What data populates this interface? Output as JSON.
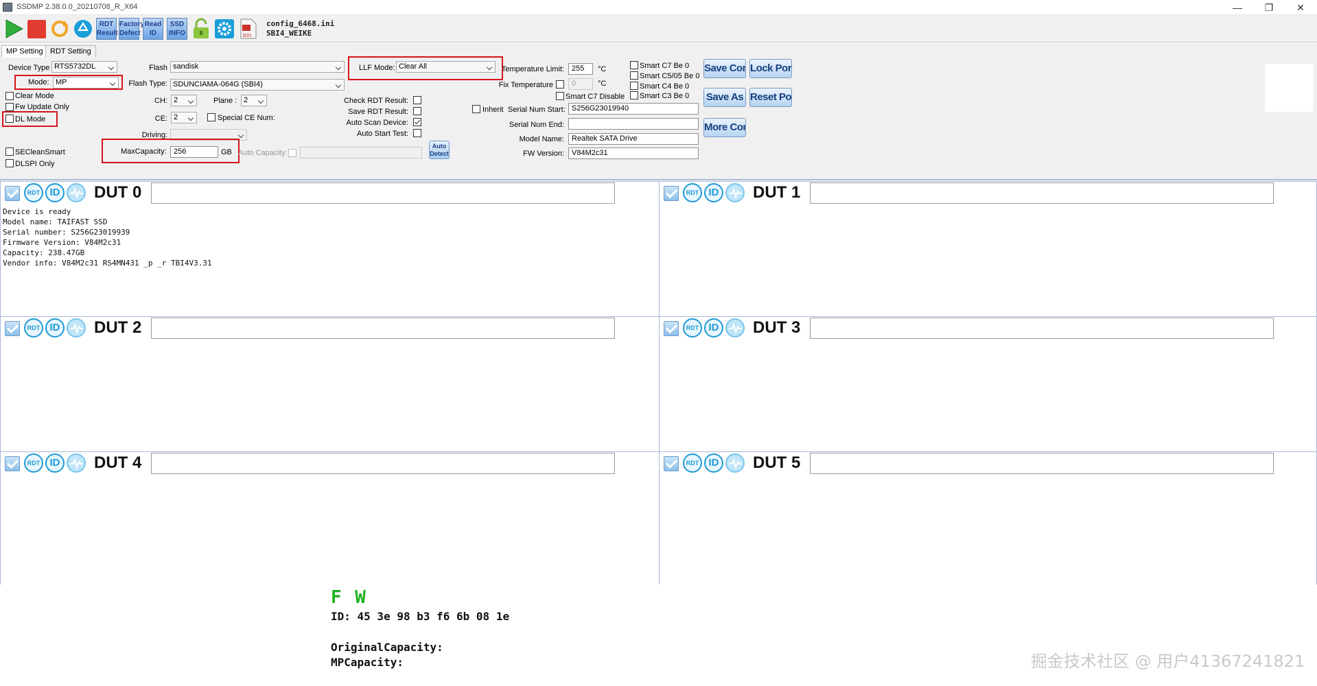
{
  "window": {
    "title": "SSDMP 2.38.0.0_20210708_R_X64",
    "minimize_glyph": "—",
    "restore_glyph": "❐",
    "close_glyph": "✕"
  },
  "toolbar": {
    "start_icon": "play-icon",
    "stop_icon": "stop-icon",
    "refresh_icon": "refresh-icon",
    "recycle_icon": "recycle-icon",
    "rdt_result_label": "RDT Result",
    "factory_defect_label": "Factory Defect",
    "read_id_label": "Read ID",
    "ssd_info_label": "SSD INFO",
    "lock_icon": "unlock-icon",
    "settings_icon": "gear-icon",
    "bin_icon": "bin-file-icon",
    "bin_label": "bin",
    "config_file": "config_6468.ini",
    "config_name": "SBI4_WEIKE"
  },
  "tabs": [
    {
      "label": "MP Setting",
      "active": true
    },
    {
      "label": "RDT Setting",
      "active": false
    }
  ],
  "settings": {
    "device_type_label": "Device Type",
    "device_type_value": "RTS5732DL",
    "mode_label": "Mode:",
    "mode_value": "MP",
    "clear_mode_label": "Clear Mode",
    "fw_update_only_label": "Fw Update Only",
    "dl_mode_label": "DL Mode",
    "se_clean_smart_label": "SECleanSmart",
    "dlspi_only_label": "DLSPI Only",
    "flash_label": "Flash",
    "flash_value": "sandisk",
    "flash_type_label": "Flash Type:",
    "flash_type_value": "SDUNCIAMA-064G (SBI4)",
    "ch_label": "CH:",
    "ch_value": "2",
    "plane_label": "Plane :",
    "plane_value": "2",
    "ce_label": "CE:",
    "ce_value": "2",
    "special_ce_label": "Special CE Num:",
    "driving_label": "Driving:",
    "driving_value": "",
    "max_capacity_label": "MaxCapacity:",
    "max_capacity_value": "256",
    "max_capacity_unit": "GB",
    "auto_capacity_label": "Auto Capacity:",
    "auto_capacity_value": "",
    "llf_mode_label": "LLF Mode:",
    "llf_mode_value": "Clear All",
    "check_rdt_label": "Check RDT Result:",
    "save_rdt_label": "Save RDT Result:",
    "auto_scan_label": "Auto Scan Device:",
    "auto_start_label": "Auto Start Test:",
    "auto_detect_label": "Auto Detect",
    "temp_limit_label": "Temperature Limit:",
    "temp_limit_value": "255",
    "temp_unit": "°C",
    "fix_temp_label": "Fix Temperature",
    "fix_temp_value": "0",
    "smart_c7_disable_label": "Smart C7 Disable",
    "inherit_sn_label": "Inherit",
    "sn_start_label": "Serial Num Start:",
    "sn_start_value": "S256G23019940",
    "sn_end_label": "Serial Num End:",
    "sn_end_value": "",
    "model_name_label": "Model Name:",
    "model_name_value": "Realtek SATA Drive",
    "fw_version_label": "FW Version:",
    "fw_version_value": "V84M2c31",
    "smart_checks": [
      "Smart C7 Be 0",
      "Smart C5/05 Be 0",
      "Smart C4 Be 0",
      "Smart C3 Be 0"
    ]
  },
  "buttons": {
    "save_config": "Save Config",
    "lock_port": "Lock Port",
    "save_as": "Save As",
    "reset_port": "Reset Port",
    "more_config": "More Config"
  },
  "duts": [
    {
      "label": "DUT 0",
      "rdt": "RDT",
      "id": "ID",
      "bar": "",
      "log": "Device is ready\nModel name: TAIFAST SSD\nSerial number: S256G23019939\nFirmware Version: V84M2c31\nCapacity: 238.47GB\nVendor info: V84M2c31 RS4MN431 _p _r TBI4V3.31"
    },
    {
      "label": "DUT 1",
      "rdt": "RDT",
      "id": "ID",
      "bar": "",
      "log": ""
    },
    {
      "label": "DUT 2",
      "rdt": "RDT",
      "id": "ID",
      "bar": "",
      "log": ""
    },
    {
      "label": "DUT 3",
      "rdt": "RDT",
      "id": "ID",
      "bar": "",
      "log": ""
    },
    {
      "label": "DUT 4",
      "rdt": "RDT",
      "id": "ID",
      "bar": "",
      "log": ""
    },
    {
      "label": "DUT 5",
      "rdt": "RDT",
      "id": "ID",
      "bar": "",
      "log": ""
    }
  ],
  "bottom": {
    "fw_title": "F W",
    "id_line": "ID: 45 3e 98 b3 f6 6b 08 1e",
    "original_capacity": "OriginalCapacity:",
    "mp_capacity": "MPCapacity:",
    "watermark": "掘金技术社区 @ 用户41367241821"
  },
  "colors": {
    "highlight_red": "#d6131b",
    "fw_green": "#1eb01e",
    "accent_blue": "#1f9ad6"
  }
}
